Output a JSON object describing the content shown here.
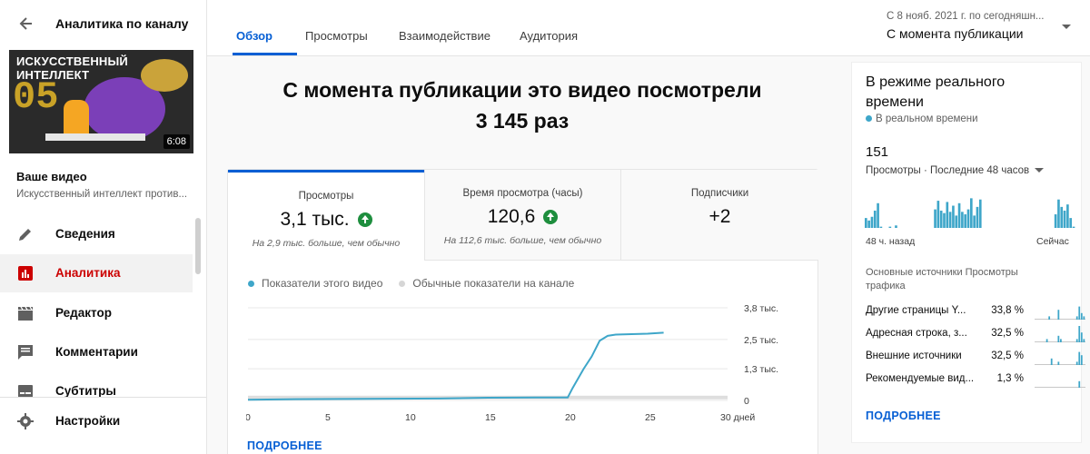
{
  "sidebar": {
    "title": "Аналитика по каналу",
    "thumbnail": {
      "title": "ИСКУССТВЕННЫЙ ИНТЕЛЛЕКТ",
      "number": "05",
      "duration": "6:08"
    },
    "your_video": "Ваше видео",
    "video_title": "Искусственный интеллект против...",
    "nav": [
      {
        "label": "Сведения",
        "icon": "pencil-icon"
      },
      {
        "label": "Аналитика",
        "icon": "analytics-icon",
        "active": true
      },
      {
        "label": "Редактор",
        "icon": "clapperboard-icon"
      },
      {
        "label": "Комментарии",
        "icon": "comment-icon"
      },
      {
        "label": "Субтитры",
        "icon": "subtitles-icon"
      },
      {
        "label": "Настройки",
        "icon": "gear-icon"
      }
    ]
  },
  "tabs": [
    {
      "label": "Обзор",
      "active": true
    },
    {
      "label": "Просмотры"
    },
    {
      "label": "Взаимодействие"
    },
    {
      "label": "Аудитория"
    }
  ],
  "date_range": {
    "sub": "С 8 нояб. 2021 г. по сегодняшн...",
    "main": "С момента публикации"
  },
  "headline": {
    "line1": "С момента публикации это видео посмотрели",
    "line2": "3 145 раз"
  },
  "metrics": [
    {
      "label": "Просмотры",
      "value": "3,1 тыс.",
      "note": "На 2,9 тыс. больше, чем обычно",
      "trend": "up"
    },
    {
      "label": "Время просмотра (часы)",
      "value": "120,6",
      "note": "На 112,6 тыс. больше, чем обычно",
      "trend": "up"
    },
    {
      "label": "Подписчики",
      "value": "+2",
      "note": ""
    }
  ],
  "legend": {
    "this_video": "Показатели этого видео",
    "typical": "Обычные показатели на канале"
  },
  "colors": {
    "accent": "#065fd4",
    "series": "#3ea6c9",
    "typical": "#d6d6d6",
    "up": "#1e8e3e",
    "active_nav": "#cc0000"
  },
  "more_label": "ПОДРОБНЕЕ",
  "chart_data": {
    "type": "line",
    "x_ticks": [
      "0",
      "5",
      "10",
      "15",
      "20",
      "25",
      "30 дней"
    ],
    "y_ticks": [
      "0",
      "1,3 тыс.",
      "2,5 тыс.",
      "3,8 тыс."
    ],
    "ylim": [
      0,
      3800
    ],
    "xlim": [
      0,
      30
    ],
    "series": [
      {
        "name": "Показатели этого видео",
        "x": [
          0,
          3,
          6,
          9,
          12,
          15,
          18,
          20,
          20.3,
          21,
          21.5,
          22,
          22.5,
          23,
          24,
          25,
          26
        ],
        "y": [
          30,
          50,
          60,
          70,
          80,
          110,
          120,
          120,
          500,
          1300,
          1800,
          2450,
          2650,
          2700,
          2720,
          2740,
          2780
        ]
      }
    ]
  },
  "realtime": {
    "title": "В режиме реального времени",
    "live": "В реальном времени",
    "count": "151",
    "metric": "Просмотры · Последние 48 часов",
    "axis_start": "48 ч. назад",
    "axis_end": "Сейчас",
    "bars": [
      8,
      6,
      9,
      14,
      20,
      1,
      0,
      0,
      1,
      0,
      2,
      0,
      0,
      0,
      0,
      0,
      0,
      0,
      0,
      0,
      0,
      0,
      0,
      15,
      22,
      14,
      12,
      21,
      13,
      18,
      10,
      20,
      13,
      11,
      15,
      24,
      10,
      17,
      23,
      0,
      0,
      0,
      0,
      0,
      0,
      0,
      0,
      0,
      0,
      0,
      0,
      0,
      0,
      0,
      0,
      0,
      0,
      0,
      0,
      0,
      0,
      0,
      0,
      11,
      23,
      17,
      14,
      19,
      8,
      1
    ],
    "sources_title": "Основные источники Просмотры трафика",
    "sources": [
      {
        "name": "Другие страницы Y...",
        "pct": "33,8 %",
        "spark": [
          0,
          0,
          0,
          0,
          0,
          0,
          1,
          0,
          0,
          0,
          3,
          0,
          0,
          0,
          0,
          0,
          0,
          0,
          1,
          4,
          2,
          1
        ]
      },
      {
        "name": "Адресная строка, з...",
        "pct": "32,5 %",
        "spark": [
          0,
          0,
          0,
          0,
          0,
          1,
          0,
          0,
          0,
          0,
          2,
          1,
          0,
          0,
          0,
          0,
          0,
          0,
          1,
          5,
          3,
          1
        ]
      },
      {
        "name": "Внешние источники",
        "pct": "32,5 %",
        "spark": [
          0,
          0,
          0,
          0,
          0,
          0,
          0,
          2,
          0,
          0,
          1,
          0,
          0,
          0,
          0,
          0,
          0,
          0,
          1,
          4,
          3,
          0
        ]
      },
      {
        "name": "Рекомендуемые вид...",
        "pct": "1,3 %",
        "spark": [
          0,
          0,
          0,
          0,
          0,
          0,
          0,
          0,
          0,
          0,
          0,
          0,
          0,
          0,
          0,
          0,
          0,
          0,
          0,
          2,
          0,
          0
        ]
      }
    ]
  }
}
